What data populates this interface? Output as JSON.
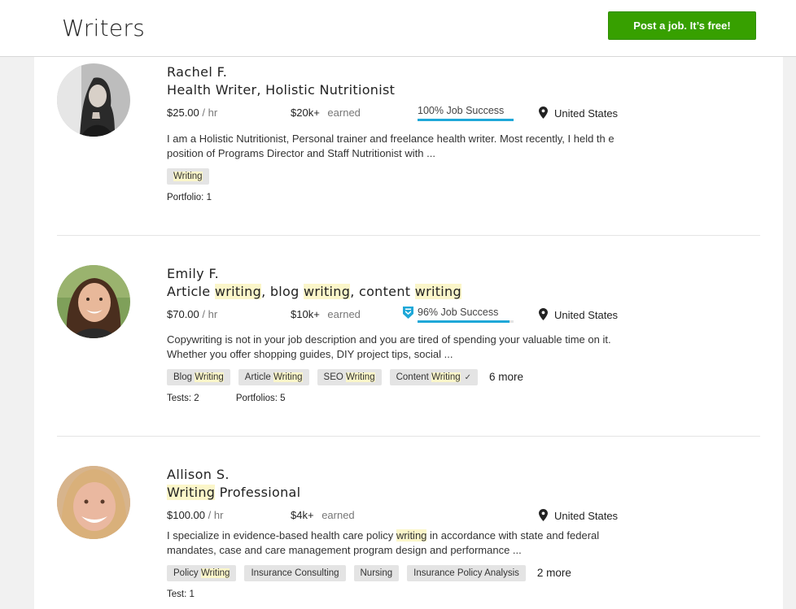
{
  "header": {
    "title": "Writers",
    "post_job_label": "Post a job. It’s free!"
  },
  "freelancers": [
    {
      "name": "Rachel F.",
      "title_parts": [
        {
          "t": "Health Writer, Holistic Nutritionist",
          "h": false
        }
      ],
      "rate": "$25.00",
      "rate_unit": "/ hr",
      "earned": "$20k+",
      "earned_label": "earned",
      "job_success": "100% Job Success",
      "job_success_fraction": 1.0,
      "top_rated": false,
      "location": "United States",
      "description_parts": [
        {
          "t": "I am a Holistic Nutritionist, Personal trainer and freelance health writer. Most recently, I held th e position of Programs Director and Staff Nutritionist with ...",
          "h": false
        }
      ],
      "tags": [
        [
          {
            "t": "Writing",
            "h": true
          }
        ]
      ],
      "tag_checks": [
        false
      ],
      "more": "",
      "meta": [
        "Portfolio: 1"
      ]
    },
    {
      "name": "Emily F.",
      "title_parts": [
        {
          "t": "Article ",
          "h": false
        },
        {
          "t": "writing",
          "h": true
        },
        {
          "t": ", blog ",
          "h": false
        },
        {
          "t": "writing",
          "h": true
        },
        {
          "t": ", content ",
          "h": false
        },
        {
          "t": "writing",
          "h": true
        }
      ],
      "rate": "$70.00",
      "rate_unit": "/ hr",
      "earned": "$10k+",
      "earned_label": "earned",
      "job_success": "96% Job Success",
      "job_success_fraction": 0.96,
      "top_rated": true,
      "location": "United States",
      "description_parts": [
        {
          "t": "Copywriting is not in your job description and you are tired of spending your valuable time on it. Whether you offer shopping guides, DIY project tips, social ...",
          "h": false
        }
      ],
      "tags": [
        [
          {
            "t": "Blog ",
            "h": false
          },
          {
            "t": "Writing",
            "h": true
          }
        ],
        [
          {
            "t": "Article ",
            "h": false
          },
          {
            "t": "Writing",
            "h": true
          }
        ],
        [
          {
            "t": "SEO ",
            "h": false
          },
          {
            "t": "Writing",
            "h": true
          }
        ],
        [
          {
            "t": "Content ",
            "h": false
          },
          {
            "t": "Writing",
            "h": true
          }
        ]
      ],
      "tag_checks": [
        false,
        false,
        false,
        true
      ],
      "more": "6 more",
      "meta": [
        "Tests: 2",
        "Portfolios: 5"
      ]
    },
    {
      "name": "Allison S.",
      "title_parts": [
        {
          "t": "Writing",
          "h": true
        },
        {
          "t": " Professional",
          "h": false
        }
      ],
      "rate": "$100.00",
      "rate_unit": "/ hr",
      "earned": "$4k+",
      "earned_label": "earned",
      "job_success": "",
      "job_success_fraction": 0,
      "top_rated": false,
      "location": "United States",
      "description_parts": [
        {
          "t": "I specialize in evidence-based health care policy ",
          "h": false
        },
        {
          "t": "writing",
          "h": true
        },
        {
          "t": " in accordance with state and federal mandates, case and care management program design and performance ...",
          "h": false
        }
      ],
      "tags": [
        [
          {
            "t": "Policy ",
            "h": false
          },
          {
            "t": "Writing",
            "h": true
          }
        ],
        [
          {
            "t": "Insurance Consulting",
            "h": false
          }
        ],
        [
          {
            "t": "Nursing",
            "h": false
          }
        ],
        [
          {
            "t": "Insurance Policy Analysis",
            "h": false
          }
        ]
      ],
      "tag_checks": [
        false,
        false,
        false,
        false
      ],
      "more": "2 more",
      "meta": [
        "Test: 1"
      ]
    }
  ],
  "colors": {
    "accent_green": "#37a000",
    "job_success_blue": "#1fa8d8",
    "highlight": "#fbf6c9"
  }
}
